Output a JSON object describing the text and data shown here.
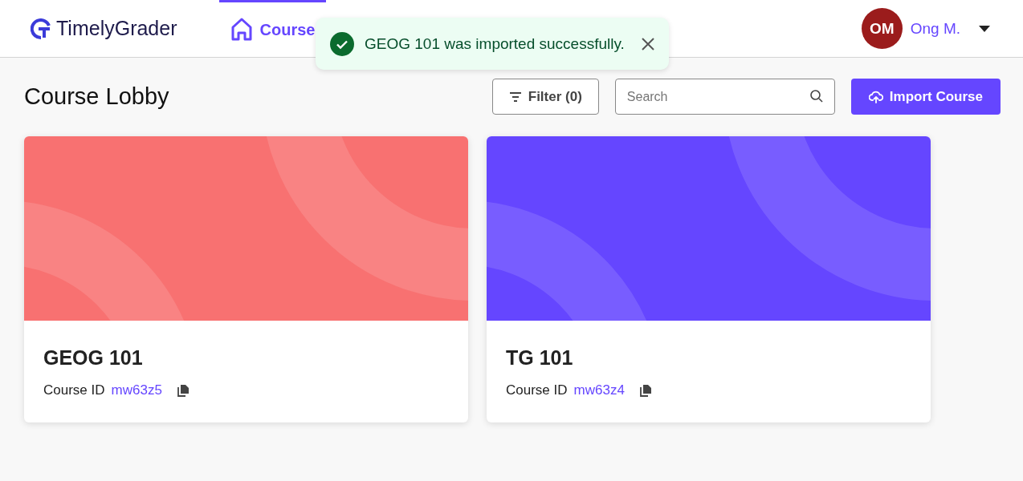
{
  "header": {
    "logo": "TimelyGrader",
    "nav": [
      {
        "label": "Course",
        "selected": true
      }
    ],
    "user": {
      "initials": "OM",
      "name": "Ong M."
    }
  },
  "toast": {
    "kind": "success",
    "message": "GEOG 101 was imported successfully."
  },
  "page": {
    "title": "Course Lobby",
    "filter_button": "Filter (0)",
    "search": {
      "placeholder": "Search"
    },
    "import_button": "Import Course"
  },
  "courses": [
    {
      "name": "GEOG 101",
      "id_label": "Course ID",
      "id": "mw63z5",
      "color": "#f87171"
    },
    {
      "name": "TG 101",
      "id_label": "Course ID",
      "id": "mw63z4",
      "color": "#6546ff"
    }
  ]
}
